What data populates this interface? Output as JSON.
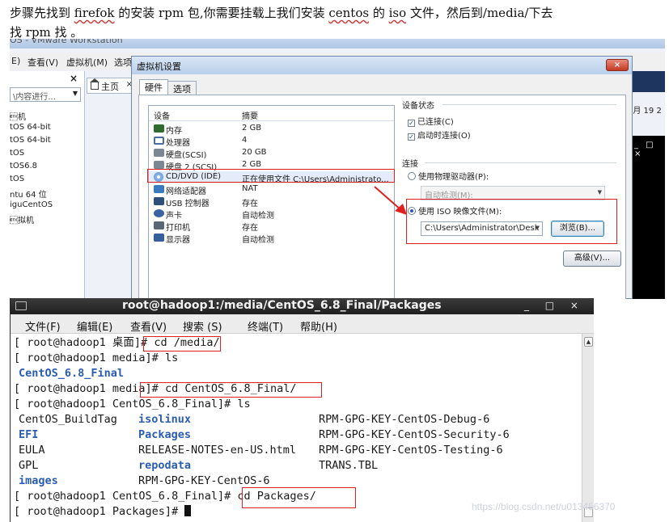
{
  "doc": {
    "line1_a": "步骤先找到 ",
    "line1_b": "firefok",
    "line1_c": " 的安装 rpm 包,你需要挂载上我们安装 ",
    "line1_d": "centos",
    "line1_e": " 的 ",
    "line1_f": "iso",
    "line1_g": " 文件，然后到/media/下去",
    "line2": "找 rpm 找 。"
  },
  "vmware": {
    "title": "OS - VMware Workstation",
    "menu": [
      "E)",
      "查看(V)",
      "虚拟机(M)",
      "选项"
    ],
    "library": {
      "close": "×",
      "search_placeholder": "\\内容进行...",
      "items": [
        "\u0003机",
        "tOS 64-bit",
        "tOS 64-bit",
        "tOS",
        "tOS6.8",
        "tOS",
        "ntu 64 位",
        "iguCentOS",
        "\u0003拟机"
      ]
    },
    "home_tab": "主页",
    "date_text": "3月 19 2",
    "desktop_ctrl": "_ □ ×"
  },
  "dialog": {
    "title": "虚拟机设置",
    "close": "×",
    "tabs": [
      "硬件",
      "选项"
    ],
    "columns": [
      "设备",
      "摘要"
    ],
    "devices": [
      {
        "name": "内存",
        "summary": "2 GB",
        "icon": "memory-icon",
        "color": "#2f6a2f"
      },
      {
        "name": "处理器",
        "summary": "4",
        "icon": "cpu-icon",
        "color": "#4a6f9a"
      },
      {
        "name": "硬盘(SCSI)",
        "summary": "20 GB",
        "icon": "harddisk-icon",
        "color": "#7c8794"
      },
      {
        "name": "硬盘 2 (SCSI)",
        "summary": "2 GB",
        "icon": "harddisk-icon",
        "color": "#7c8794"
      },
      {
        "name": "CD/DVD (IDE)",
        "summary": "正在使用文件 C:\\Users\\Administrato...",
        "icon": "cdrom-icon",
        "color": "#8fb8e6"
      },
      {
        "name": "网络适配器",
        "summary": "NAT",
        "icon": "network-icon",
        "color": "#3a7bbf"
      },
      {
        "name": "USB 控制器",
        "summary": "存在",
        "icon": "usb-icon",
        "color": "#2c4f7c"
      },
      {
        "name": "声卡",
        "summary": "自动检测",
        "icon": "sound-icon",
        "color": "#3a62a3"
      },
      {
        "name": "打印机",
        "summary": "存在",
        "icon": "printer-icon",
        "color": "#5b6675"
      },
      {
        "name": "显示器",
        "summary": "自动检测",
        "icon": "display-icon",
        "color": "#345f9c"
      }
    ],
    "device_status": {
      "label": "设备状态",
      "connected": "已连接(C)",
      "connect_on_power": "启动时连接(O)"
    },
    "connection": {
      "label": "连接",
      "physical": "使用物理驱动器(P):",
      "auto_detect": "自动检测(M):",
      "iso": "使用 ISO 映像文件(M):",
      "iso_path": "C:\\Users\\Administrator\\Desk",
      "browse": "浏览(B)...",
      "advanced": "高级(V)..."
    }
  },
  "terminal": {
    "title": "root@hadoop1:/media/CentOS_6.8_Final/Packages",
    "controls": "_ □ ×",
    "menu": [
      "文件(F)",
      "编辑(E)",
      "查看(V)",
      "搜索 (S)",
      "终端(T)",
      "帮助(H)"
    ],
    "lines": [
      {
        "prompt": "[ root@hadoop1 桌面]# ",
        "cmd": "cd /media/"
      },
      {
        "prompt": "[ root@hadoop1 media]# ",
        "cmd": "ls"
      },
      {
        "dir": "CentOS_6.8_Final"
      },
      {
        "prompt": "[ root@hadoop1 media]# ",
        "cmd": "cd CentOS_6.8_Final/"
      },
      {
        "prompt": "[ root@hadoop1 CentOS_6.8_Final]# ",
        "cmd": "ls"
      }
    ],
    "ls_columns": {
      "col1": [
        "CentOS_BuildTag",
        "EFI",
        "EULA",
        "GPL",
        "images"
      ],
      "col2": [
        "isolinux",
        "Packages",
        "RELEASE-NOTES-en-US.html",
        "repodata",
        "RPM-GPG-KEY-CentOS-6"
      ],
      "col3": [
        "RPM-GPG-KEY-CentOS-Debug-6",
        "RPM-GPG-KEY-CentOS-Security-6",
        "RPM-GPG-KEY-CentOS-Testing-6",
        "TRANS.TBL"
      ]
    },
    "final_prompt": "[ root@hadoop1 CentOS_6.8_Final]# ",
    "final_cmd": "cd Packages/",
    "last_prompt": "[ root@hadoop1 Packages]# "
  },
  "watermark": "https://blog.csdn.net/u013456370"
}
